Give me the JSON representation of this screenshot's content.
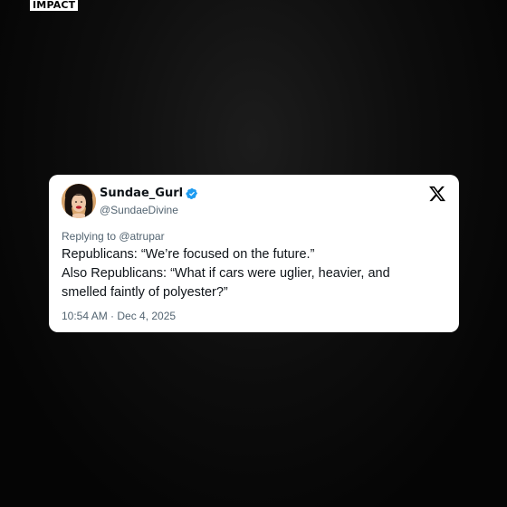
{
  "brand": {
    "logo_text": "IMPACT"
  },
  "tweet": {
    "display_name": "Sundae_Gurl",
    "handle": "@SundaeDivine",
    "replying_to": "Replying to @atrupar",
    "lines": [
      "Republicans: “We’re focused on the future.”",
      "Also Republicans: “What if cars were uglier, heavier, and",
      "smelled faintly of polyester?”"
    ],
    "timestamp": "10:54 AM · Dec 4, 2025",
    "verified": true
  },
  "icons": {
    "verified": "verified-badge-icon",
    "platform": "x-logo-icon"
  },
  "colors": {
    "background": "#050505",
    "card": "#ffffff",
    "text_primary": "#0f1419",
    "text_secondary": "#536471",
    "verified_blue": "#1d9bf0"
  }
}
